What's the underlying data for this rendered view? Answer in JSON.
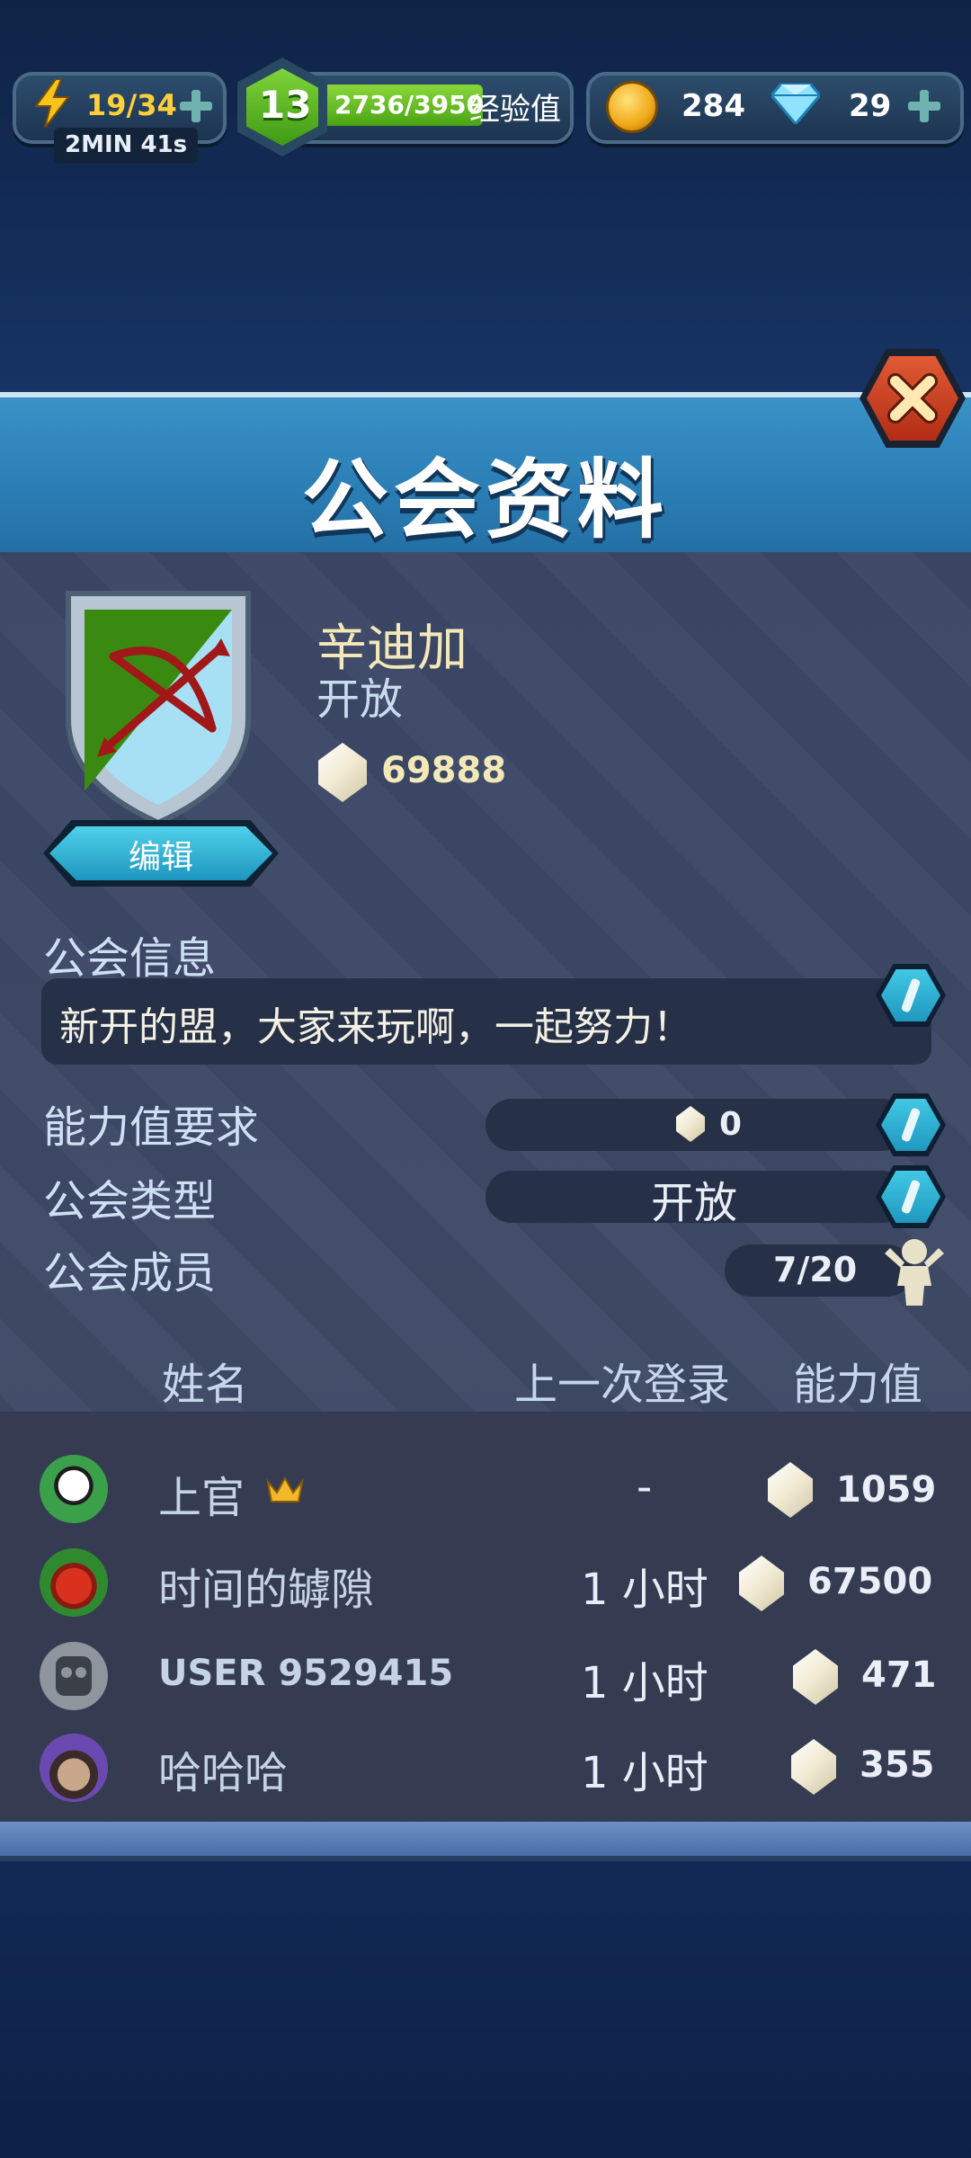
{
  "hud": {
    "energy": "19/34",
    "energy_timer": "2MIN 41s",
    "level": "13",
    "xp": "2736/3950",
    "xp_label": "经验值",
    "xp_progress": 0.693,
    "coins": "284",
    "diamonds": "29"
  },
  "banner": {
    "title": "公会资料"
  },
  "guild": {
    "name": "辛迪加",
    "status": "开放",
    "power": "69888",
    "edit_label": "编辑",
    "info_label": "公会信息",
    "info_text": "新开的盟，大家来玩啊，一起努力！",
    "power_req_label": "能力值要求",
    "power_req_value": "0",
    "type_label": "公会类型",
    "type_value": "开放",
    "members_label": "公会成员",
    "members_value": "7/20"
  },
  "table": {
    "col_name": "姓名",
    "col_last_login": "上一次登录",
    "col_power": "能力值",
    "rows": [
      {
        "name": "上官",
        "last_login": "-",
        "power": "1059"
      },
      {
        "name": "时间的罅隙",
        "last_login": "1 小时",
        "power": "67500"
      },
      {
        "name": "USER 9529415",
        "last_login": "1 小时",
        "power": "471"
      },
      {
        "name": "哈哈哈",
        "last_login": "1 小时",
        "power": "355"
      }
    ]
  },
  "colors": {
    "banner_blue": "#2b7fb6",
    "panel": "#3f4a66",
    "accent_cyan": "#42c7e4",
    "crest_green": "#3a8a12",
    "crest_lightblue": "#a7e0f5",
    "close_red": "#c0391f"
  }
}
